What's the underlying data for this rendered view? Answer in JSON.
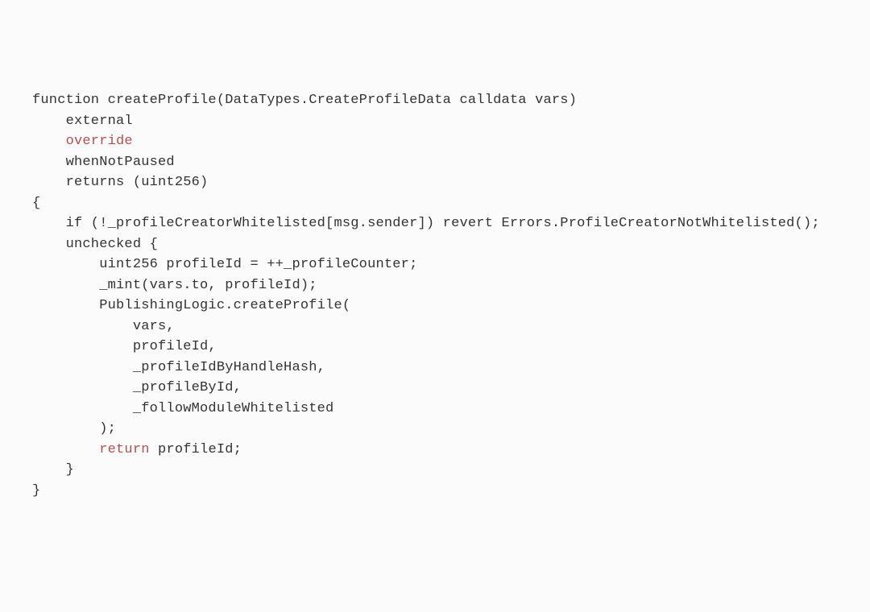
{
  "code": {
    "line1": "function createProfile(DataTypes.CreateProfileData calldata vars)",
    "line2": "    external",
    "line3": "    override",
    "line4": "    whenNotPaused",
    "line5": "    returns (uint256)",
    "line6": "{",
    "line7": "    if (!_profileCreatorWhitelisted[msg.sender]) revert Errors.ProfileCreatorNotWhitelisted();",
    "line8": "    unchecked {",
    "line9": "        uint256 profileId = ++_profileCounter;",
    "line10": "        _mint(vars.to, profileId);",
    "line11": "        PublishingLogic.createProfile(",
    "line12": "            vars,",
    "line13": "            profileId,",
    "line14": "            _profileIdByHandleHash,",
    "line15": "            _profileById,",
    "line16": "            _followModuleWhitelisted",
    "line17": "        );",
    "line18_pre": "        ",
    "line18_kw": "return",
    "line18_post": " profileId;",
    "line19": "    }",
    "line20": "}"
  }
}
